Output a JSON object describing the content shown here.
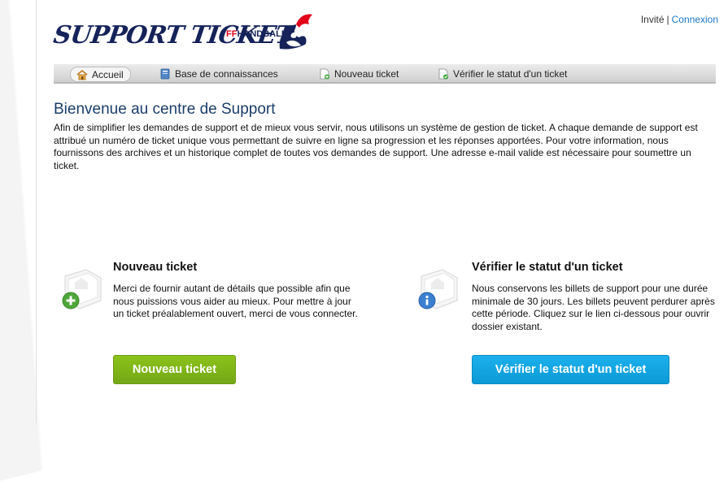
{
  "header": {
    "logo_text": "SUPPORT TICKET",
    "logo_ff": "FF",
    "logo_handball": "HANDBALL",
    "user_label": "Invité",
    "separator": "|",
    "login_link": "Connexion"
  },
  "nav": {
    "items": [
      {
        "label": "Accueil",
        "icon": "home-icon"
      },
      {
        "label": "Base de connaissances",
        "icon": "book-icon"
      },
      {
        "label": "Nouveau ticket",
        "icon": "new-ticket-icon"
      },
      {
        "label": "Vérifier le statut d'un ticket",
        "icon": "check-status-icon"
      }
    ]
  },
  "main": {
    "title": "Bienvenue au centre de Support",
    "intro": "Afin de simplifier les demandes de support et de mieux vous servir, nous utilisons un système de gestion de ticket. A chaque demande de support est attribué un numéro de ticket unique vous permettant de suivre en ligne sa progression et les réponses apportées. Pour votre information, nous fournissons des archives et un historique complet de toutes vos demandes de support. Une adresse e-mail valide est nécessaire pour soumettre un ticket."
  },
  "new_ticket": {
    "icon": "new-ticket-large-icon",
    "title": "Nouveau ticket",
    "text": "Merci de fournir autant de détails que possible afin que nous puissions vous aider au mieux. Pour mettre à jour un ticket préalablement ouvert, merci de vous connecter.",
    "button": "Nouveau ticket",
    "button_color": "#7db518"
  },
  "check_status": {
    "icon": "info-ticket-large-icon",
    "title": "Vérifier le statut d'un ticket",
    "text": "Nous conservons les billets de support pour une durée minimale de 30 jours. Les billets peuvent perdurer après cette période. Cliquez sur le lien ci-dessous pour ouvrir dossier existant.",
    "button": "Vérifier le statut d'un ticket",
    "button_color": "#12a5e3"
  },
  "colors": {
    "link": "#1a76c2",
    "title": "#1b3d6b",
    "brand_navy": "#15235a",
    "brand_red": "#e2001a"
  }
}
